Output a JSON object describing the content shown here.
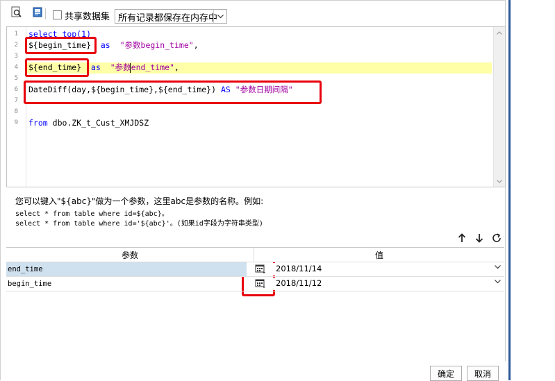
{
  "toolbar": {
    "share_dataset_label": "共享数据集",
    "storage_select_value": "所有记录都保存在内存中"
  },
  "editor": {
    "line_numbers": [
      "1",
      "2",
      "3",
      "4",
      "5",
      "6",
      "7",
      "8",
      "9"
    ],
    "lines": {
      "l1_kw": "select top",
      "l1_rest": "(1)",
      "l2_param": "${begin_time}",
      "l2_as": "as",
      "l2_alias": "\"参数begin_time\"",
      "l2_comma": ",",
      "l4_param": "${end_time}",
      "l4_as": "as",
      "l4_alias": "\"参数end_time\"",
      "l4_comma": ",",
      "l6_func": "DateDiff(day,${begin_time},${end_time})",
      "l6_as": "AS",
      "l6_alias": "\"参数日期间隔\"",
      "l9_kw": "from",
      "l9_rest": "dbo.ZK_t_Cust_XMJDSZ"
    }
  },
  "help": {
    "line1": "您可以键入\"${abc}\"做为一个参数，这里abc是参数的名称。例如:",
    "line2": "select * from table where id=${abc}。",
    "line3": "select * from table where id='${abc}'。(如果id字段为字符串类型)"
  },
  "params_table": {
    "col_param": "参数",
    "col_value": "值",
    "rows": [
      {
        "name": "end_time",
        "value": "2018/11/14"
      },
      {
        "name": "begin_time",
        "value": "2018/11/12"
      }
    ]
  },
  "buttons": {
    "ok": "确定",
    "cancel": "取消"
  },
  "colors": {
    "highlight_box": "#e8000b",
    "keyword": "#0000ff",
    "current_line": "#ffffa8",
    "selected_row": "#cfe0ee"
  },
  "icons": [
    "query-designer-icon",
    "preview-icon",
    "calendar-icon",
    "arrow-up-icon",
    "arrow-down-icon",
    "refresh-icon",
    "chevron-down-icon"
  ]
}
